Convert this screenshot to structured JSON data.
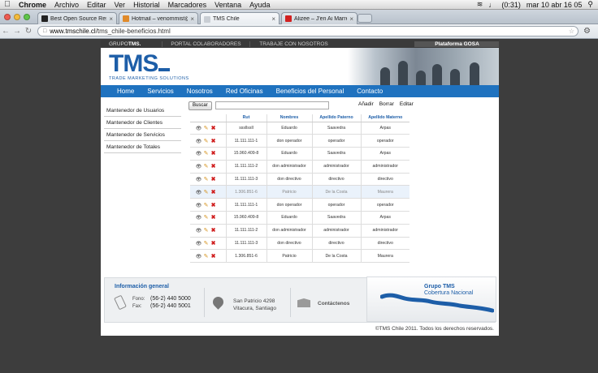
{
  "macbar": {
    "app": "Chrome",
    "menus": [
      "Archivo",
      "Editar",
      "Ver",
      "Historial",
      "Marcadores",
      "Ventana",
      "Ayuda"
    ],
    "battery": "(0:31)",
    "clock": "mar 10 abr  16 05"
  },
  "browser": {
    "tabs": [
      {
        "title": "Best Open Source Resources",
        "color": "#222222"
      },
      {
        "title": "Hotmail – venommist@live.cl",
        "color": "#e08a2a"
      },
      {
        "title": "TMS Chile",
        "color": "#c9ced4"
      },
      {
        "title": "Alizee – J'en Ai Marre (Tube",
        "color": "#d12020"
      }
    ],
    "url_host": "www.tmschile.cl",
    "url_path": "/tms_chile-beneficios.html"
  },
  "site": {
    "topnav": {
      "logo": "GRUPO",
      "logo_bold": "TMS.",
      "portal": "PORTAL COLABORADORES",
      "trabajo": "TRABAJE CON NOSOTROS",
      "gosa": "Plataforma GOSA"
    },
    "brand": {
      "name": "TMS",
      "tagline": "TRADE MARKETING SOLUTIONS"
    },
    "mainnav": [
      "Home",
      "Servicios",
      "Nosotros",
      "Red Oficinas",
      "Beneficios del Personal",
      "Contacto"
    ],
    "sidebar": [
      "Mantenedor de Usuarios",
      "Mantenedor de Clientes",
      "Mantenedor de Servicios",
      "Mantenedor de Totales"
    ],
    "search_button": "Buscar",
    "actions": [
      "Añadir",
      "Borrar",
      "Editar"
    ],
    "table": {
      "headers": [
        "Rut",
        "Nombres",
        "Apellido Paterno",
        "Apellido Materno"
      ],
      "rows": [
        [
          "sssllssll",
          "Eduardo",
          "Saavedra",
          "Arpas"
        ],
        [
          "11.111.111-1",
          "don operador",
          "operador",
          "operador"
        ],
        [
          "15.960.409-8",
          "Eduardo",
          "Saavedra",
          "Arpas"
        ],
        [
          "11.111.111-2",
          "don administrador",
          "administrador",
          "administrador"
        ],
        [
          "11.111.111-3",
          "don directivo",
          "directivo",
          "directivo"
        ],
        [
          "1.306.851-6",
          "Patricio",
          "De la Costa",
          "Maurera"
        ],
        [
          "11.111.111-1",
          "don operador",
          "operador",
          "operador"
        ],
        [
          "15.960.409-8",
          "Eduardo",
          "Saavedra",
          "Arpas"
        ],
        [
          "11.111.111-2",
          "don administrador",
          "administrador",
          "administrador"
        ],
        [
          "11.111.111-3",
          "don directivo",
          "directivo",
          "directivo"
        ],
        [
          "1.306.851-6",
          "Patricio",
          "De la Costa",
          "Maurera"
        ]
      ],
      "selected_row": 5
    },
    "footer": {
      "title": "Información general",
      "fono_label": "Fono:",
      "fono": "(56-2) 440 5000",
      "fax_label": "Fax:",
      "fax": "(56-2) 440 5001",
      "address1": "San Patricio 4298",
      "address2": "Vitacura, Santiago",
      "contact": "Contáctenos",
      "group": "Grupo TMS",
      "coverage": "Cobertura Nacional"
    },
    "copyright": "©TMS Chile 2011. Todos los derechos reservados."
  }
}
